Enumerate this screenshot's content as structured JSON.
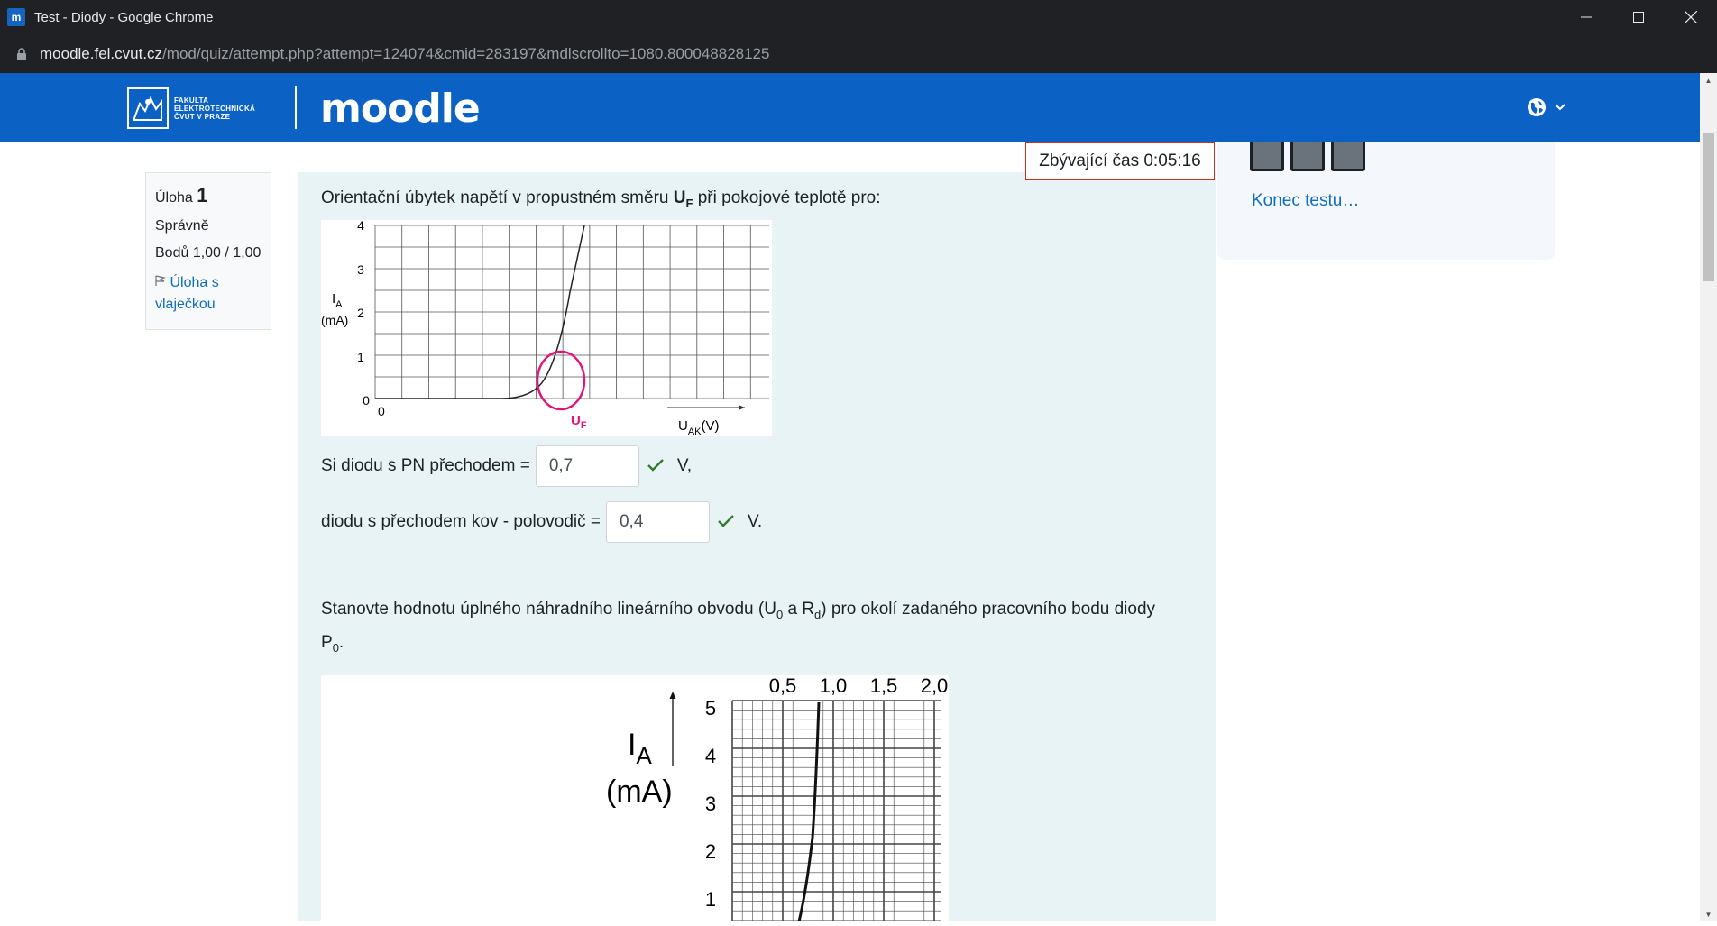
{
  "browser": {
    "window_title": "Test - Diody - Google Chrome",
    "favicon_text": "m",
    "url_host": "moodle.fel.cvut.cz",
    "url_path": "/mod/quiz/attempt.php?attempt=124074&cmid=283197&mdlscrollto=1080.800048828125"
  },
  "navbar": {
    "institution_lines": [
      "FAKULTA",
      "ELEKTROTECHNICKÁ",
      "ČVUT V PRAZE"
    ],
    "brand": "moodle",
    "lang_icon": "globe-icon"
  },
  "question_info": {
    "label": "Úloha",
    "number": "1",
    "state": "Správně",
    "points": "Bodů 1,00 / 1,00",
    "flag_label": "Úloha s vlaječkou"
  },
  "question": {
    "text_before": "Orientační úbytek napětí v propustném směru ",
    "symbol": "U",
    "symbol_sub": "F",
    "text_after": "  při pokojové teplotě pro:",
    "row1_label": "Si diodu s PN přechodem =",
    "row1_value": "0,7",
    "row1_unit": "V,",
    "row2_label": "diodu s přechodem kov - polovodič =",
    "row2_value": "0,4",
    "row2_unit": "V.",
    "text2_a": "Stanovte hodnotu úplného náhradního lineárního obvodu (U",
    "text2_sub1": "0",
    "text2_b": " a R",
    "text2_sub2": "d",
    "text2_c": ") pro okolí zadaného pracovního bodu diody P",
    "text2_sub3": "0",
    "text2_d": "."
  },
  "chart1": {
    "y_label": "I",
    "y_label_sub": "A",
    "y_unit": "(mA)",
    "y_ticks": [
      "0",
      "1",
      "2",
      "3",
      "4"
    ],
    "x_origin": "0",
    "x_label": "U",
    "x_label_sub": "AK",
    "x_unit": "(V)",
    "marker_label": "U",
    "marker_sub": "F",
    "marker_color": "#e0157a"
  },
  "chart2": {
    "x_ticks": [
      "0,5",
      "1,0",
      "1,5",
      "2,0"
    ],
    "y_ticks": [
      "5",
      "4",
      "3",
      "2",
      "1"
    ],
    "y_label": "I",
    "y_label_sub": "A",
    "y_unit": "(mA)"
  },
  "timer": {
    "text": "Zbývající čas 0:05:16"
  },
  "quiz_nav": {
    "finish_label": "Konec testu…"
  },
  "colors": {
    "navbar": "#0b62c4",
    "content_bg": "#e7f3f5",
    "link": "#0f6cbf",
    "correct": "#357a32",
    "timer_border": "#ca3120"
  }
}
